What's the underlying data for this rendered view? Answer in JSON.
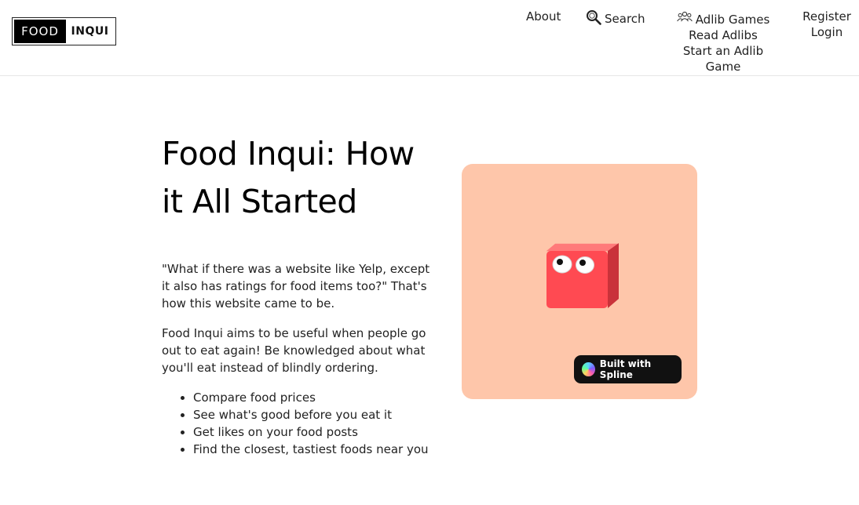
{
  "logo": {
    "left": "FOOD",
    "right": "INQUI"
  },
  "nav": {
    "about": "About",
    "search": "Search",
    "adlib_games": "Adlib Games",
    "read_adlibs": "Read Adlibs",
    "start_adlib": "Start an Adlib Game",
    "register": "Register",
    "login": "Login",
    "icons": {
      "search": "magnifier-icon",
      "adlib": "people-group-icon"
    }
  },
  "main": {
    "title": "Food Inqui: How it All Started",
    "paragraph1": "\"What if there was a website like Yelp, except it also has ratings for food items too?\" That's how this website came to be.",
    "paragraph2": "Food Inqui aims to be useful when people go out to eat again! Be knowledged about what you'll eat instead of blindly ordering.",
    "features": [
      "Compare food prices",
      "See what's good before you eat it",
      "Get likes on your food posts",
      "Find the closest, tastiest foods near you"
    ]
  },
  "spline": {
    "badge": "Built with Spline",
    "bg_color": "#fec6aa",
    "cube_color": "#ff4a52"
  }
}
